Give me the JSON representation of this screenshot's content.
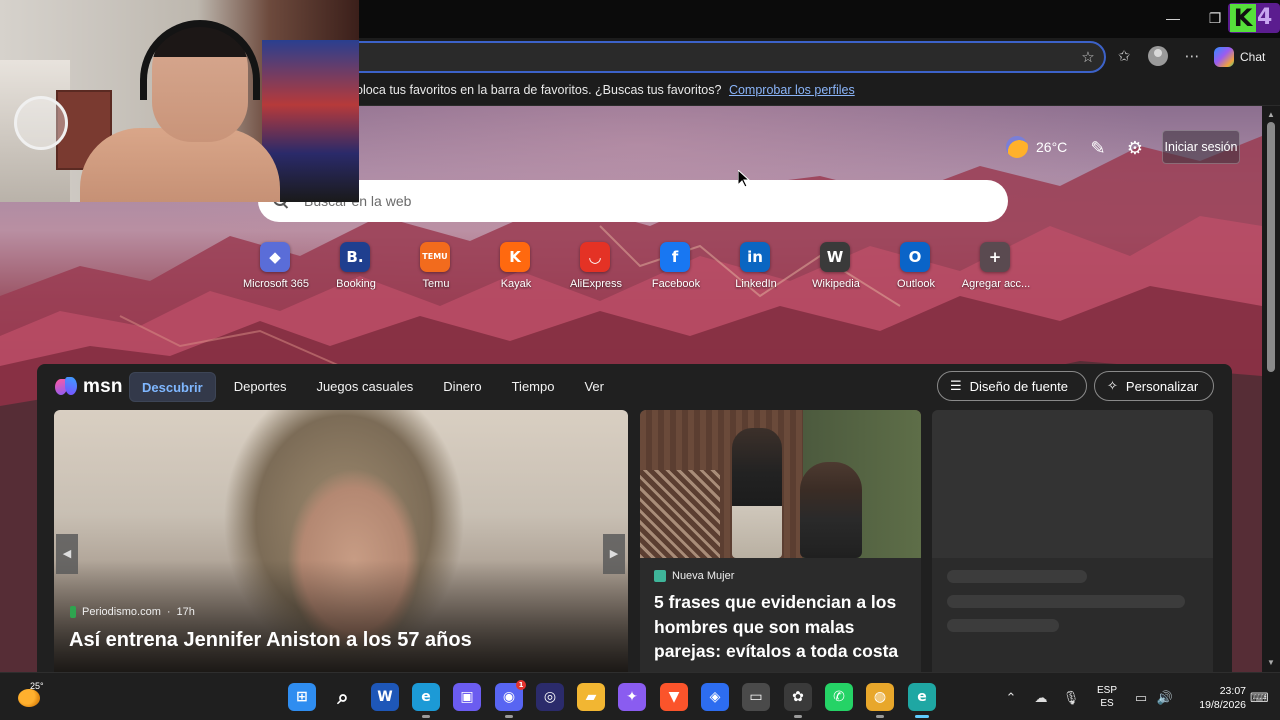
{
  "window": {
    "minimize_glyph": "—",
    "restore_glyph": "❐",
    "overlay_logo_letters": "K4"
  },
  "toolbar": {
    "chat_label": "Chat"
  },
  "favorites_bar": {
    "message": "oloca tus favoritos en la barra de favoritos. ¿Buscas tus favoritos?",
    "link": "Comprobar los perfiles"
  },
  "new_tab": {
    "weather_temp": "26°C",
    "signin_label": "Iniciar sesión",
    "search_placeholder": "Buscar en la web",
    "quick_links": [
      {
        "label": "Microsoft 365",
        "glyph": "◆",
        "color": "#5a6dd8"
      },
      {
        "label": "Booking",
        "glyph": "B.",
        "color": "#1f3f8f"
      },
      {
        "label": "Temu",
        "glyph": "TEMU",
        "color": "#f26b1d"
      },
      {
        "label": "Kayak",
        "glyph": "K",
        "color": "#ff690f"
      },
      {
        "label": "AliExpress",
        "glyph": "◡",
        "color": "#e43225"
      },
      {
        "label": "Facebook",
        "glyph": "f",
        "color": "#1877f2"
      },
      {
        "label": "LinkedIn",
        "glyph": "in",
        "color": "#0a66c2"
      },
      {
        "label": "Wikipedia",
        "glyph": "W",
        "color": "#3a3a3a"
      },
      {
        "label": "Outlook",
        "glyph": "O",
        "color": "#0a64c8"
      },
      {
        "label": "Agregar acc...",
        "glyph": "+",
        "color": "#5a4a50"
      }
    ]
  },
  "msn": {
    "logo_text": "msn",
    "tabs": [
      "Descubrir",
      "Deportes",
      "Juegos casuales",
      "Dinero",
      "Tiempo",
      "Ver"
    ],
    "active_tab": "Descubrir",
    "feed_layout_label": "Diseño de fuente",
    "personalize_label": "Personalizar",
    "hero": {
      "source": "Periodismo.com",
      "age": "17h",
      "headline": "Así entrena Jennifer Aniston a los 57 años"
    },
    "card2": {
      "source": "Nueva Mujer",
      "headline": "5 frases que evidencian a los hombres que son malas parejas: evítalos a toda costa"
    }
  },
  "taskbar": {
    "weather_temp": "25°",
    "apps": [
      {
        "name": "windows-start",
        "glyph": "⊞",
        "color": "#2f8df0"
      },
      {
        "name": "search",
        "glyph": "⌕",
        "color": "transparent"
      },
      {
        "name": "word",
        "glyph": "W",
        "color": "#1e57b8"
      },
      {
        "name": "edge-beta",
        "glyph": "e",
        "color": "#1c9ad6"
      },
      {
        "name": "app-store",
        "glyph": "▣",
        "color": "#6b5cf0"
      },
      {
        "name": "discord",
        "glyph": "◉",
        "color": "#5865f2"
      },
      {
        "name": "obs-like",
        "glyph": "◎",
        "color": "#2b2b6b"
      },
      {
        "name": "file-explorer",
        "glyph": "▰",
        "color": "#f2b632"
      },
      {
        "name": "copilot",
        "glyph": "✦",
        "color": "#8a5cf0"
      },
      {
        "name": "brave",
        "glyph": "▼",
        "color": "#fb542b"
      },
      {
        "name": "vpn",
        "glyph": "◈",
        "color": "#2d6df0"
      },
      {
        "name": "terminal",
        "glyph": "▭",
        "color": "#4a4a4a"
      },
      {
        "name": "davinci",
        "glyph": "✿",
        "color": "#3a3a3a"
      },
      {
        "name": "whatsapp",
        "glyph": "✆",
        "color": "#25d366"
      },
      {
        "name": "chrome",
        "glyph": "◍",
        "color": "#e8a72b"
      },
      {
        "name": "edge",
        "glyph": "e",
        "color": "#1fa7a3"
      }
    ],
    "discord_badge": "1",
    "lang_top": "ESP",
    "lang_bottom": "ES",
    "time": "23:07",
    "date": "19/8/2026"
  },
  "colors": {
    "accent": "#3c62c9",
    "link": "#8ab4f8",
    "msn_active": "#7fb7ff"
  }
}
